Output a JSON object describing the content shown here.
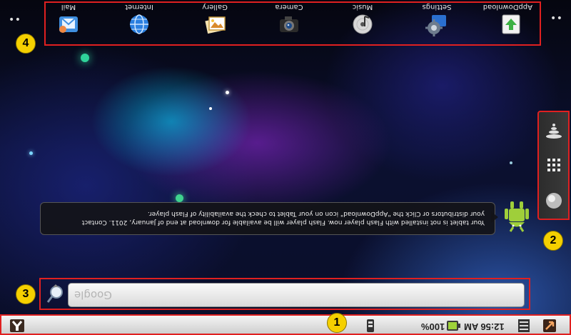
{
  "apps": [
    {
      "label": "Mail",
      "icon": "mail-icon"
    },
    {
      "label": "Internet",
      "icon": "globe-icon"
    },
    {
      "label": "Gallery",
      "icon": "gallery-icon"
    },
    {
      "label": "Camera",
      "icon": "camera-icon"
    },
    {
      "label": "Music",
      "icon": "music-disc-icon"
    },
    {
      "label": "Settings",
      "icon": "settings-gear-icon"
    },
    {
      "label": "AppDownload",
      "icon": "download-arrow-icon"
    }
  ],
  "badges": {
    "one": "1",
    "two": "2",
    "three": "3",
    "four": "4"
  },
  "notification": {
    "line1": "Your tablet is not installed with Flash player now. Flash player will be available for download at end of January, 2011. Contact",
    "line2": "your distributors or Click the \"AppDownload\" icon on your Tablet to check the availability of Flash player."
  },
  "search": {
    "placeholder": "Google"
  },
  "status": {
    "battery_percent": "100%",
    "time": "12:56 AM"
  },
  "colors": {
    "annotation_border": "#e02020",
    "badge": "#f5d000"
  }
}
